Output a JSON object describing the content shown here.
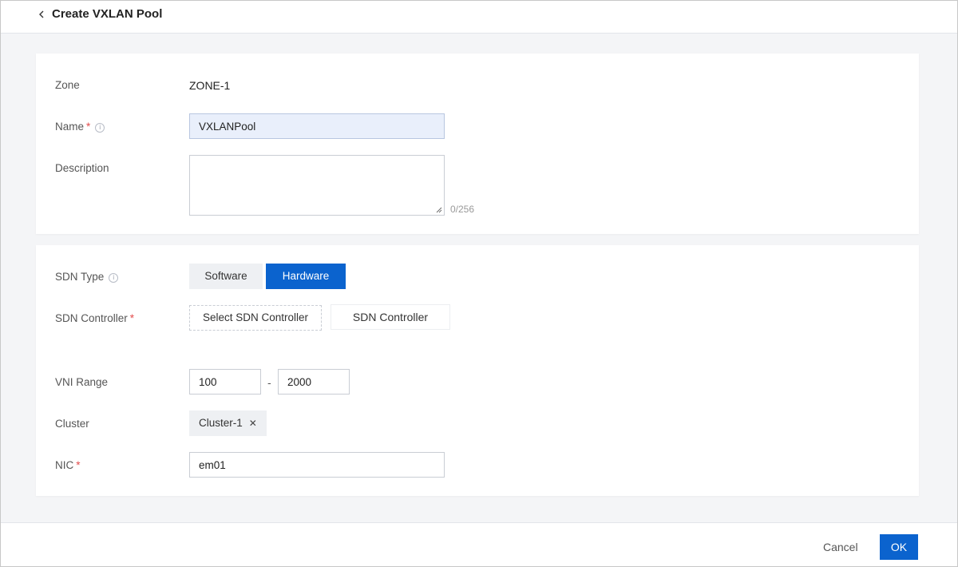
{
  "header": {
    "back_icon": "chevron-left-icon",
    "title": "Create VXLAN Pool"
  },
  "basic": {
    "zone_label": "Zone",
    "zone_value": "ZONE-1",
    "name_label": "Name",
    "name_required": "*",
    "name_value": "VXLANPool",
    "description_label": "Description",
    "description_value": "",
    "description_counter": "0/256"
  },
  "network": {
    "sdn_type_label": "SDN Type",
    "sdn_type_options": [
      "Software",
      "Hardware"
    ],
    "sdn_type_selected": "Hardware",
    "sdn_controller_label": "SDN Controller",
    "sdn_controller_required": "*",
    "sdn_controller_select": "Select SDN Controller",
    "sdn_controller_value": "SDN Controller",
    "vni_range_label": "VNI Range",
    "vni_start": "100",
    "vni_separator": "-",
    "vni_end": "2000",
    "cluster_label": "Cluster",
    "cluster_tag": "Cluster-1",
    "cluster_remove_icon": "close-icon",
    "nic_label": "NIC",
    "nic_required": "*",
    "nic_value": "em01"
  },
  "footer": {
    "cancel_label": "Cancel",
    "ok_label": "OK"
  },
  "colors": {
    "primary": "#0b63ce",
    "required": "#e34d4d",
    "page_bg": "#f4f5f7"
  }
}
